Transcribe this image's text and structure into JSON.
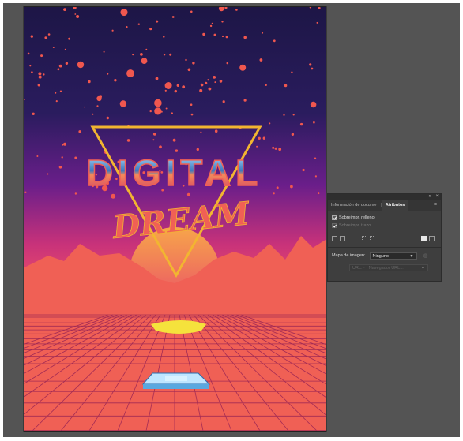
{
  "artwork": {
    "title_word1": "DIGITAL",
    "title_word2": "DREAM",
    "colors": {
      "sky_top": "#1d1646",
      "sky_mid": "#6a1e8a",
      "sky_low": "#c8327a",
      "stars": "#f0574f",
      "sun_top": "#f7a54a",
      "sun_bottom": "#e8466c",
      "triangle": "#f2b531",
      "grid": "#f06055",
      "title_chrome": "#58a8d8",
      "title_outline": "#f06055",
      "dream": "#f06055",
      "car": "#bfe6ff"
    }
  },
  "panel": {
    "controls": [
      "»",
      "×"
    ],
    "tabs": [
      {
        "label": "Información de docume"
      },
      {
        "label": "Atributos"
      }
    ],
    "menu_icon": "≡",
    "overprint_fill": {
      "label": "Sobreimpr. relleno",
      "checked": true
    },
    "overprint_stroke": {
      "label": "Sobreimpr. trazo",
      "checked": true,
      "disabled": true
    },
    "image_map": {
      "label": "Mapa de imagen:",
      "value": "Ninguno"
    },
    "url_field": {
      "value": "URL:  ·  ·  Navegador URL..."
    }
  }
}
